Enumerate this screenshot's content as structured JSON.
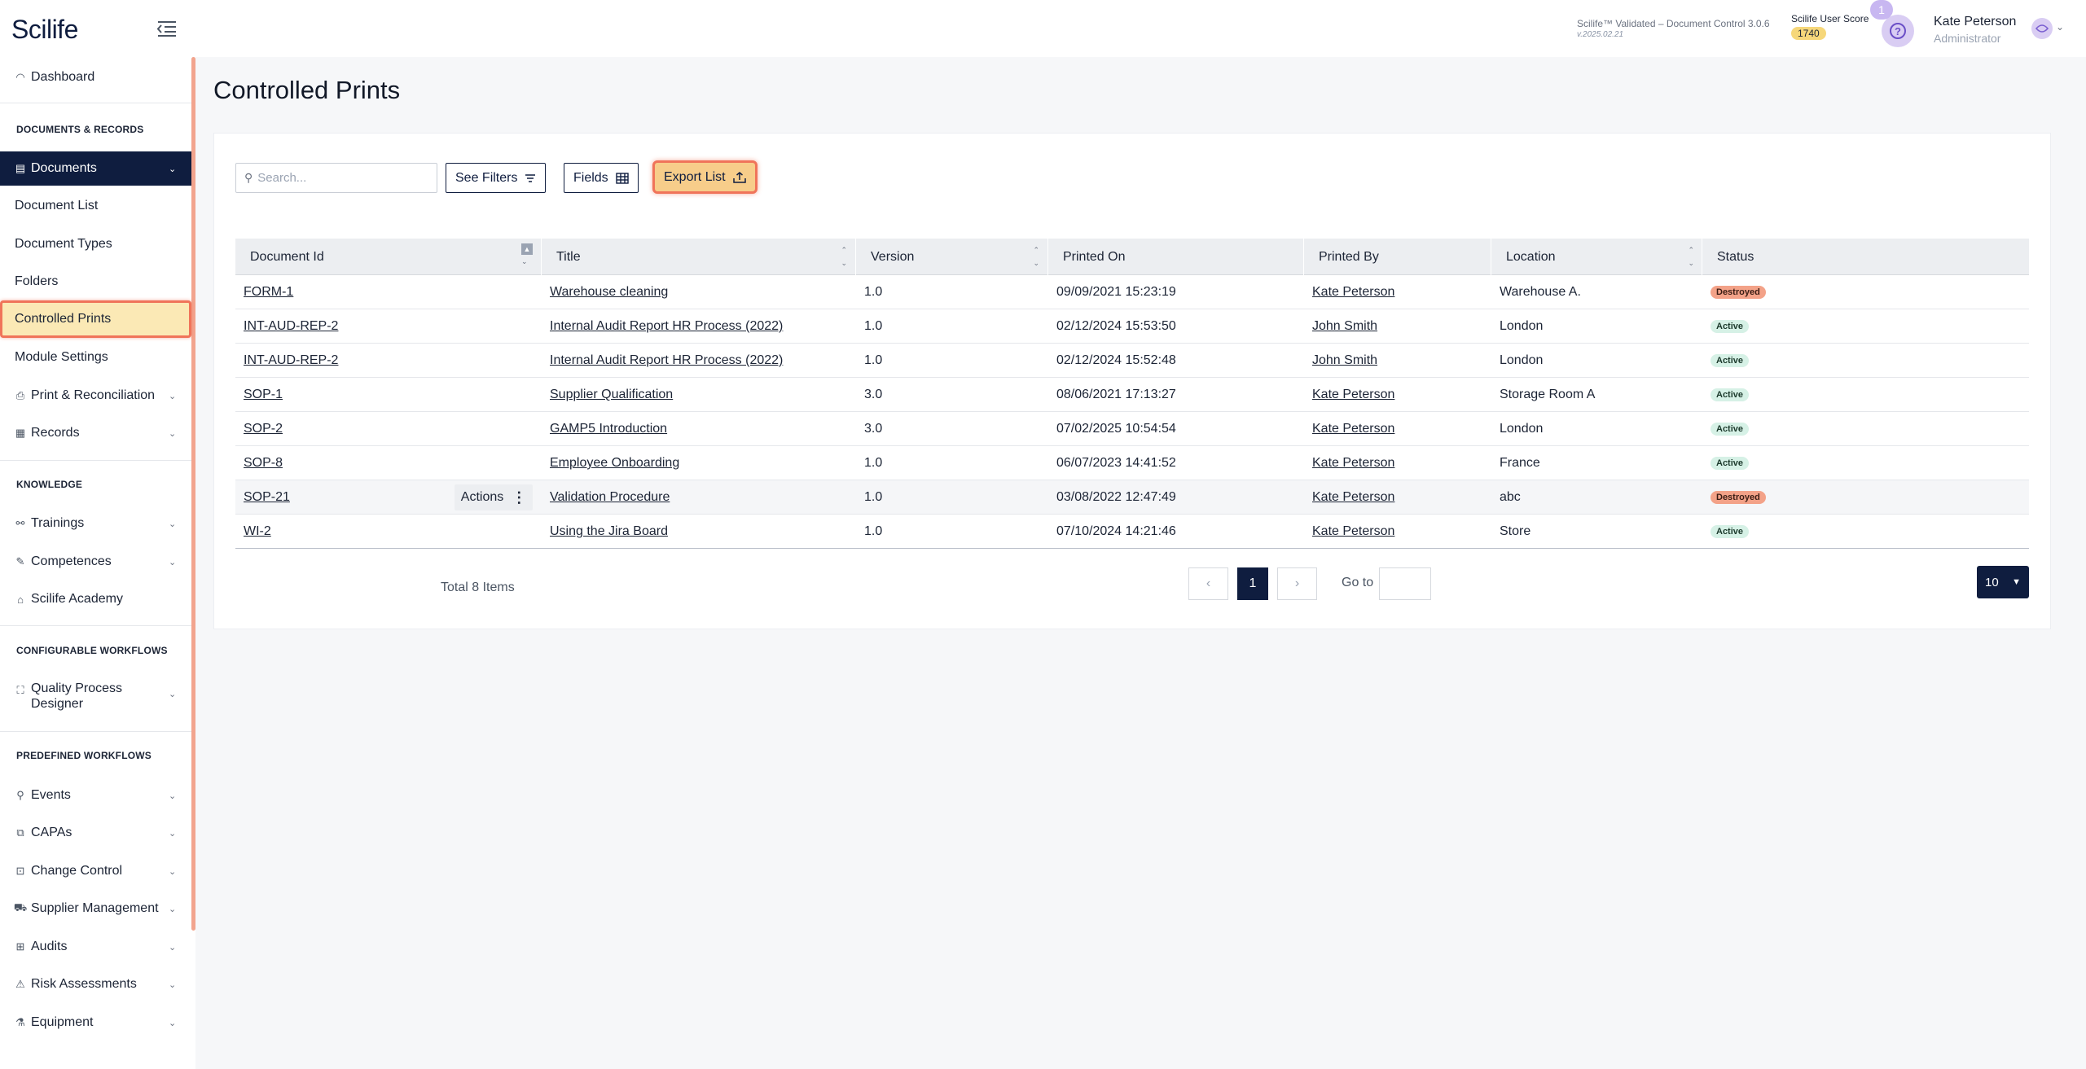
{
  "app": {
    "logo": "Scilife",
    "version_line": "Scilife™ Validated – Document Control 3.0.6",
    "version_sub": "v.2025.02.21",
    "score_label": "Scilife User Score",
    "score_value": "1740",
    "notification_count": "1",
    "help_glyph": "?",
    "user_name": "Kate Peterson",
    "user_role": "Administrator"
  },
  "sidebar": {
    "dashboard": "Dashboard",
    "section_docs": "DOCUMENTS & RECORDS",
    "documents": "Documents",
    "document_list": "Document List",
    "document_types": "Document Types",
    "folders": "Folders",
    "controlled_prints": "Controlled Prints",
    "module_settings": "Module Settings",
    "print_reconciliation": "Print & Reconciliation",
    "records": "Records",
    "section_knowledge": "KNOWLEDGE",
    "trainings": "Trainings",
    "competences": "Competences",
    "academy": "Scilife Academy",
    "section_config": "CONFIGURABLE WORKFLOWS",
    "qpd_line1": "Quality Process",
    "qpd_line2": "Designer",
    "section_predefined": "PREDEFINED WORKFLOWS",
    "events": "Events",
    "capas": "CAPAs",
    "change_control": "Change Control",
    "supplier_management": "Supplier Management",
    "audits": "Audits",
    "risk_assessments": "Risk Assessments",
    "equipment": "Equipment"
  },
  "page": {
    "title": "Controlled Prints",
    "search_placeholder": "Search...",
    "see_filters": "See Filters",
    "fields": "Fields",
    "export_list": "Export List"
  },
  "table": {
    "headers": {
      "document_id": "Document Id",
      "title": "Title",
      "version": "Version",
      "printed_on": "Printed On",
      "printed_by": "Printed By",
      "location": "Location",
      "status": "Status"
    },
    "actions_label": "Actions",
    "rows": [
      {
        "id": "FORM-1",
        "title": "Warehouse cleaning",
        "version": "1.0",
        "printed_on": "09/09/2021 15:23:19",
        "printed_by": "Kate Peterson",
        "location": "Warehouse A.",
        "status": "Destroyed"
      },
      {
        "id": "INT-AUD-REP-2",
        "title": "Internal Audit Report HR Process (2022)",
        "version": "1.0",
        "printed_on": "02/12/2024 15:53:50",
        "printed_by": "John Smith",
        "location": "London",
        "status": "Active"
      },
      {
        "id": "INT-AUD-REP-2",
        "title": "Internal Audit Report HR Process (2022)",
        "version": "1.0",
        "printed_on": "02/12/2024 15:52:48",
        "printed_by": "John Smith",
        "location": "London",
        "status": "Active"
      },
      {
        "id": "SOP-1",
        "title": "Supplier Qualification",
        "version": "3.0",
        "printed_on": "08/06/2021 17:13:27",
        "printed_by": "Kate Peterson",
        "location": "Storage Room A",
        "status": "Active"
      },
      {
        "id": "SOP-2",
        "title": "GAMP5 Introduction",
        "version": "3.0",
        "printed_on": "07/02/2025 10:54:54",
        "printed_by": "Kate Peterson",
        "location": "London",
        "status": "Active"
      },
      {
        "id": "SOP-8",
        "title": "Employee Onboarding",
        "version": "1.0",
        "printed_on": "06/07/2023 14:41:52",
        "printed_by": "Kate Peterson",
        "location": "France",
        "status": "Active"
      },
      {
        "id": "SOP-21",
        "title": "Validation Procedure",
        "version": "1.0",
        "printed_on": "03/08/2022 12:47:49",
        "printed_by": "Kate Peterson",
        "location": "abc",
        "status": "Destroyed"
      },
      {
        "id": "WI-2",
        "title": "Using the Jira Board",
        "version": "1.0",
        "printed_on": "07/10/2024 14:21:46",
        "printed_by": "Kate Peterson",
        "location": "Store",
        "status": "Active"
      }
    ]
  },
  "pagination": {
    "total": "Total 8 Items",
    "current_page": "1",
    "goto_label": "Go to",
    "page_size": "10"
  }
}
